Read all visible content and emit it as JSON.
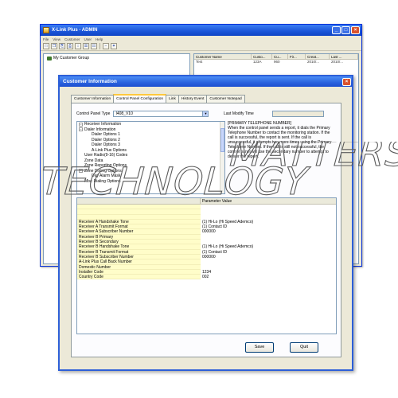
{
  "main_window": {
    "title": "X-Link Plus - ADMIN",
    "menu": [
      "File",
      "View",
      "Customer",
      "User",
      "Help"
    ],
    "toolbar_icons": [
      "new-file-icon",
      "copy-icon",
      "paste-icon",
      "print-icon",
      "sort-icon",
      "list-view-icon",
      "details-view-icon",
      "dash-icon",
      "connect-icon"
    ],
    "toolbar_glyphs": [
      "□",
      "❐",
      "⎘",
      "⎙",
      "↕",
      "☰",
      "☷",
      "−",
      "✦"
    ],
    "tree_root": "My Customer Group",
    "list_columns": [
      "Customer Name",
      "Custo...",
      "Cu...",
      "Fir...",
      "Creat...",
      "Last ..."
    ],
    "list_rows": [
      [
        "Test",
        "123A",
        "960",
        "",
        "2010/...",
        "2010/..."
      ]
    ]
  },
  "dialog": {
    "title": "Customer Information",
    "tabs": [
      "Customer Information",
      "Control Panel Configuration",
      "Link",
      "History Event",
      "Customer Notepad"
    ],
    "active_tab": 1,
    "control_panel_type_label": "Control Panel Type",
    "control_panel_type_value": "I408_V10",
    "last_modify_label": "Last Modify Time",
    "options": [
      {
        "label": "Receiver Information",
        "indent": 0,
        "expander": "−"
      },
      {
        "label": "Dialer Information",
        "indent": 0,
        "expander": "−"
      },
      {
        "label": "Dialer Options 1",
        "indent": 1,
        "expander": ""
      },
      {
        "label": "Dialer Options 2",
        "indent": 1,
        "expander": ""
      },
      {
        "label": "Dialer Options 3",
        "indent": 1,
        "expander": ""
      },
      {
        "label": "A-Link Plus Options",
        "indent": 1,
        "expander": ""
      },
      {
        "label": "User Radio(9-16) Codes",
        "indent": 0,
        "expander": ""
      },
      {
        "label": "Zone Data",
        "indent": 0,
        "expander": ""
      },
      {
        "label": "Zone Reporting Options",
        "indent": 0,
        "expander": ""
      },
      {
        "label": "Zone Dialing Options",
        "indent": 0,
        "expander": "−"
      },
      {
        "label": "Day Alarm Mask",
        "indent": 1,
        "expander": ""
      },
      {
        "label": "Misc Dialing Options",
        "indent": 0,
        "expander": ""
      }
    ],
    "description_heading": "[PRIMARY TELEPHONE NUMBER]",
    "description_body": "When the control panel sends a report, it dials the Primary Telephone Number to contact the monitoring station. If the call is successful, the report is sent. If the call is unsuccessful, it attempts two more times using the Primary Telephone Number. If the call is still not successful, the control panel will use the secondary number to attempt to deliver the report.",
    "grid_header": "Parameter Value",
    "parameters": [
      {
        "name": "",
        "value": ""
      },
      {
        "name": "",
        "value": ""
      },
      {
        "name": "",
        "value": ""
      },
      {
        "name": "Receiver A Handshake Tone",
        "value": "(1) Hi-Lo (Hi Speed Ademco)"
      },
      {
        "name": "Receiver A Transmit Format",
        "value": "(1) Contact ID"
      },
      {
        "name": "Receiver A Subscriber Number",
        "value": "000000"
      },
      {
        "name": "Receiver B Primary",
        "value": ""
      },
      {
        "name": "Receiver B Secondary",
        "value": ""
      },
      {
        "name": "Receiver B Handshake Tone",
        "value": "(1) Hi-Lo (Hi Speed Ademco)"
      },
      {
        "name": "Receiver B Transmit Format",
        "value": "(1) Contact ID"
      },
      {
        "name": "Receiver B Subscriber Number",
        "value": "000000"
      },
      {
        "name": "A-Link Plus Call Back Number",
        "value": ""
      },
      {
        "name": "Domestic Number",
        "value": ""
      },
      {
        "name": "Installer Code",
        "value": "1234"
      },
      {
        "name": "Country Code",
        "value": "002"
      }
    ],
    "save_label": "Save",
    "quit_label": "Quit"
  },
  "watermark": {
    "line1": "TECHNOLOGY",
    "line2": "MATTERS"
  }
}
